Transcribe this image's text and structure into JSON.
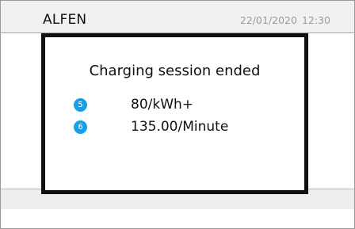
{
  "header": {
    "brand": "ALFEN",
    "date": "22/01/2020",
    "time": "12:30"
  },
  "dialog": {
    "title": "Charging session ended",
    "rates": [
      {
        "badge": "5",
        "value": "80/kWh+"
      },
      {
        "badge": "6",
        "value": "135.00/Minute"
      }
    ]
  },
  "colors": {
    "badge": "#18a0e6",
    "dialog_border": "#111111",
    "chrome_background": "#ededed",
    "datetime_text": "#9a9a9a"
  }
}
